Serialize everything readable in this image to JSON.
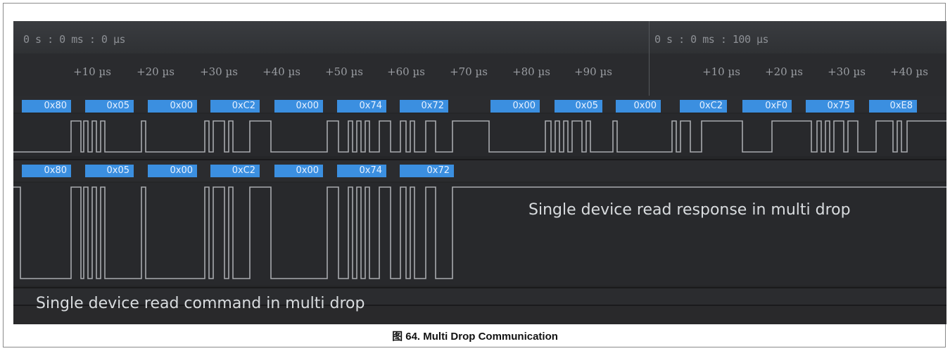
{
  "time_ruler": {
    "start_label": "0 s : 0 ms : 0 µs",
    "marker_label": "0 s : 0 ms : 100 µs",
    "ticks_first": [
      "+10 µs",
      "+20 µs",
      "+30 µs",
      "+40 µs",
      "+50 µs",
      "+60 µs",
      "+70 µs",
      "+80 µs",
      "+90 µs"
    ],
    "ticks_second": [
      "+10 µs",
      "+20 µs",
      "+30 µs",
      "+40 µs"
    ]
  },
  "channel_1": {
    "bytes": [
      "0x80",
      "0x05",
      "0x00",
      "0xC2",
      "0x00",
      "0x74",
      "0x72",
      "0x00",
      "0x05",
      "0x00",
      "0xC2",
      "0xF0",
      "0x75",
      "0xE8"
    ]
  },
  "channel_2": {
    "bytes": [
      "0x80",
      "0x05",
      "0x00",
      "0xC2",
      "0x00",
      "0x74",
      "0x72"
    ]
  },
  "annotations": {
    "response": "Single device read response in multi drop",
    "command": "Single device read command in multi drop"
  },
  "caption": "图 64. Multi Drop Communication"
}
